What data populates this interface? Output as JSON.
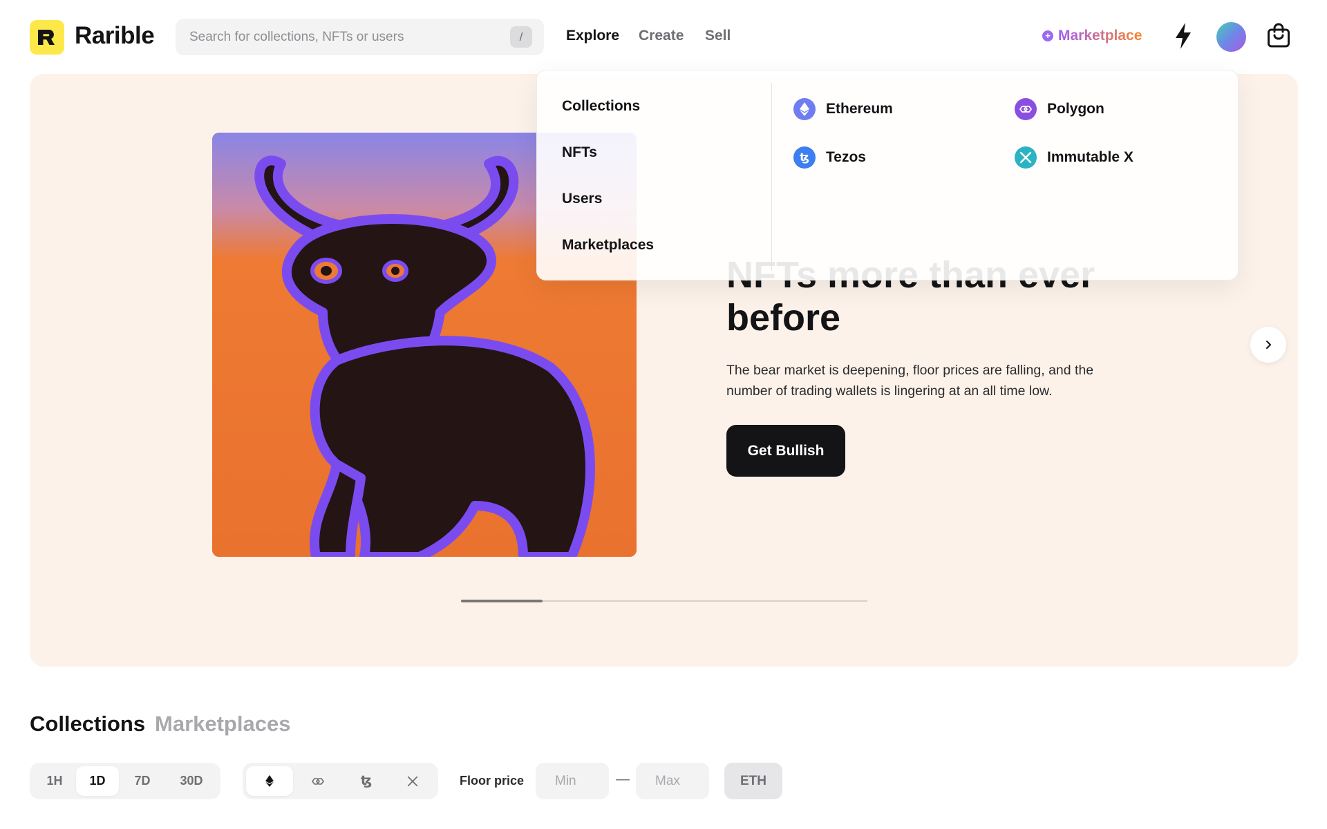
{
  "header": {
    "brand": "Rarible",
    "search_placeholder": "Search for collections, NFTs or users",
    "search_shortcut": "/",
    "nav": [
      "Explore",
      "Create",
      "Sell"
    ],
    "marketplace_label": "Marketplace"
  },
  "hero": {
    "heading_line1": "NFTs more than ever",
    "heading_line2": "before",
    "description": "The bear market is deepening, floor prices are falling, and the number of trading wallets is lingering at an all time low.",
    "cta": "Get Bullish",
    "slide_progress": 0.2
  },
  "explore_menu": {
    "items": [
      "Collections",
      "NFTs",
      "Users",
      "Marketplaces"
    ],
    "chains": [
      {
        "label": "Ethereum",
        "icon": "ethereum-icon",
        "color": "#6f7df0"
      },
      {
        "label": "Polygon",
        "icon": "polygon-icon",
        "color": "#8a4fe0"
      },
      {
        "label": "Tezos",
        "icon": "tezos-icon",
        "color": "#3d7ef0"
      },
      {
        "label": "Immutable X",
        "icon": "immutable-x-icon",
        "color": "#2bb3c2"
      }
    ]
  },
  "collections": {
    "tabs": [
      "Collections",
      "Marketplaces"
    ],
    "time_ranges": [
      "1H",
      "1D",
      "7D",
      "30D"
    ],
    "selected_range": "1D",
    "chain_filters": [
      "ethereum-icon",
      "polygon-icon",
      "tezos-icon",
      "immutable-x-icon"
    ],
    "floor_label": "Floor price",
    "min_placeholder": "Min",
    "max_placeholder": "Max",
    "range_separator": "—",
    "currency": "ETH"
  },
  "colors": {
    "brand_yellow": "#fde84a",
    "hero_bg": "#fcf2ea",
    "dark": "#141416"
  }
}
